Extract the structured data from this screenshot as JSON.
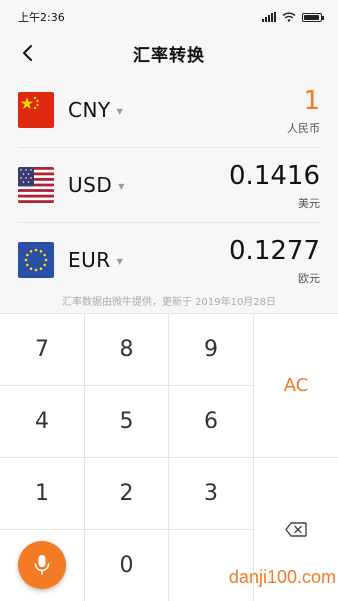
{
  "status_bar": {
    "time": "上午2:36"
  },
  "header": {
    "title": "汇率转换"
  },
  "currencies": [
    {
      "code": "CNY",
      "value": "1",
      "unit": "人民币",
      "flag_icon": "china-flag-icon",
      "active": true
    },
    {
      "code": "USD",
      "value": "0.1416",
      "unit": "美元",
      "flag_icon": "usa-flag-icon",
      "active": false
    },
    {
      "code": "EUR",
      "value": "0.1277",
      "unit": "欧元",
      "flag_icon": "eu-flag-icon",
      "active": false
    }
  ],
  "source_note": "汇率数据由微牛提供，更新于 2019年10月28日",
  "keypad": {
    "keys": [
      "7",
      "8",
      "9",
      "4",
      "5",
      "6",
      "1",
      "2",
      "3",
      "0"
    ],
    "clear_label": "AC",
    "delete_icon": "backspace-icon",
    "mic_icon": "microphone-icon"
  },
  "watermark": "danji100.com",
  "colors": {
    "accent": "#f47a24"
  }
}
